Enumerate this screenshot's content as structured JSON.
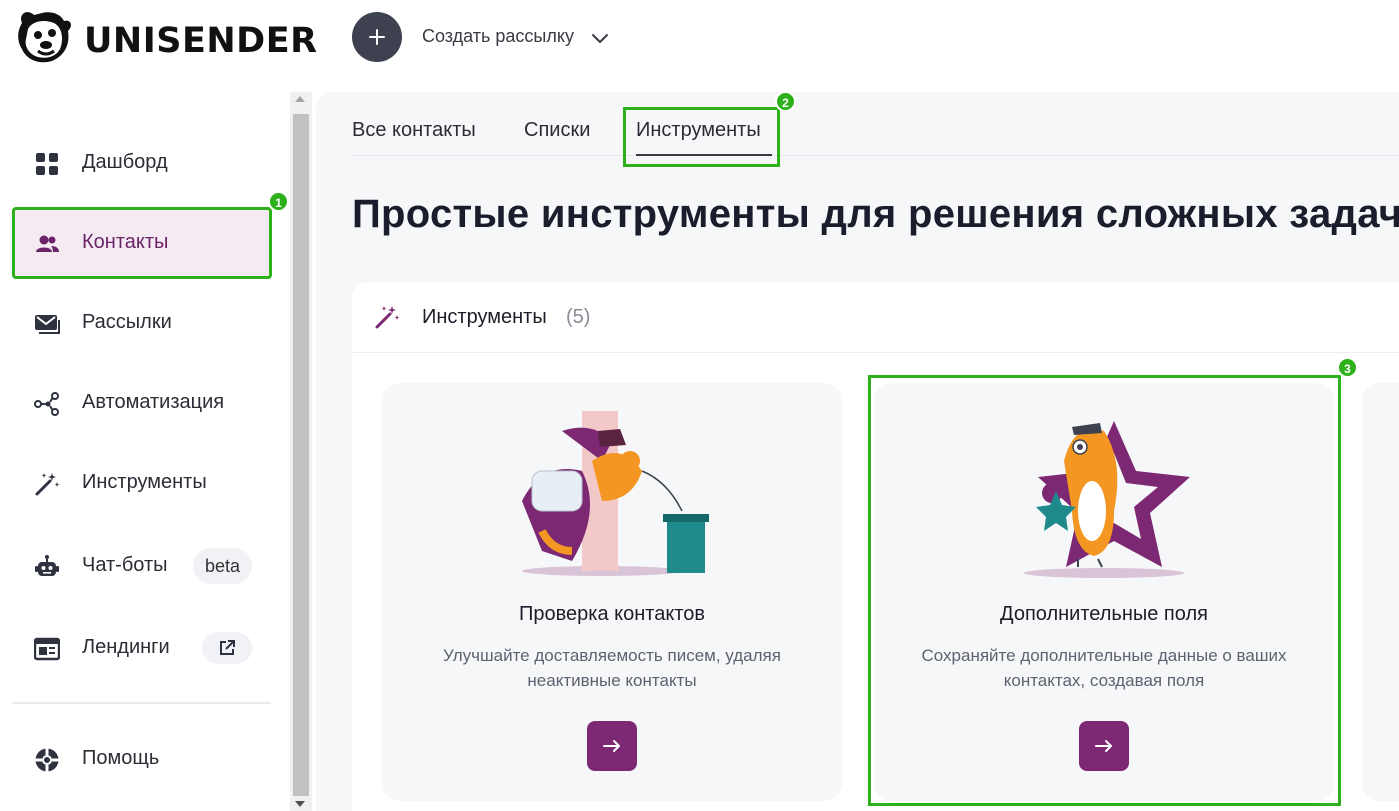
{
  "brand": {
    "name": "UNISENDER",
    "accent": "#7d2873",
    "highlight": "#2db11a"
  },
  "header": {
    "create_label": "Создать рассылку",
    "create_icon": "plus-icon",
    "dropdown_icon": "chevron-down-icon"
  },
  "sidebar": {
    "items": [
      {
        "label": "Дашборд",
        "icon": "grid-icon"
      },
      {
        "label": "Контакты",
        "icon": "users-icon",
        "active": true
      },
      {
        "label": "Рассылки",
        "icon": "mail-icon"
      },
      {
        "label": "Автоматизация",
        "icon": "share-nodes-icon"
      },
      {
        "label": "Инструменты",
        "icon": "magic-wand-icon"
      },
      {
        "label": "Чат-боты",
        "icon": "robot-icon",
        "badge": "beta"
      },
      {
        "label": "Лендинги",
        "icon": "landing-page-icon",
        "badge_icon": "external-link-icon"
      },
      {
        "label": "Помощь",
        "icon": "lifebuoy-icon"
      }
    ]
  },
  "markers": [
    "1",
    "2",
    "3"
  ],
  "tabs": [
    {
      "label": "Все контакты"
    },
    {
      "label": "Списки"
    },
    {
      "label": "Инструменты",
      "active": true
    }
  ],
  "page_title": "Простые инструменты для решения сложных задач",
  "panel": {
    "title": "Инструменты",
    "count": "(5)",
    "icon": "magic-wand-icon"
  },
  "cards": [
    {
      "title": "Проверка контактов",
      "description_line1": "Улучшайте доставляемость писем, удаляя",
      "description_line2": "неактивные контакты",
      "button_icon": "arrow-right-icon"
    },
    {
      "title": "Дополнительные поля",
      "description_line1": "Сохраняйте дополнительные данные о ваших",
      "description_line2": "контактах, создавая поля",
      "button_icon": "arrow-right-icon"
    }
  ]
}
